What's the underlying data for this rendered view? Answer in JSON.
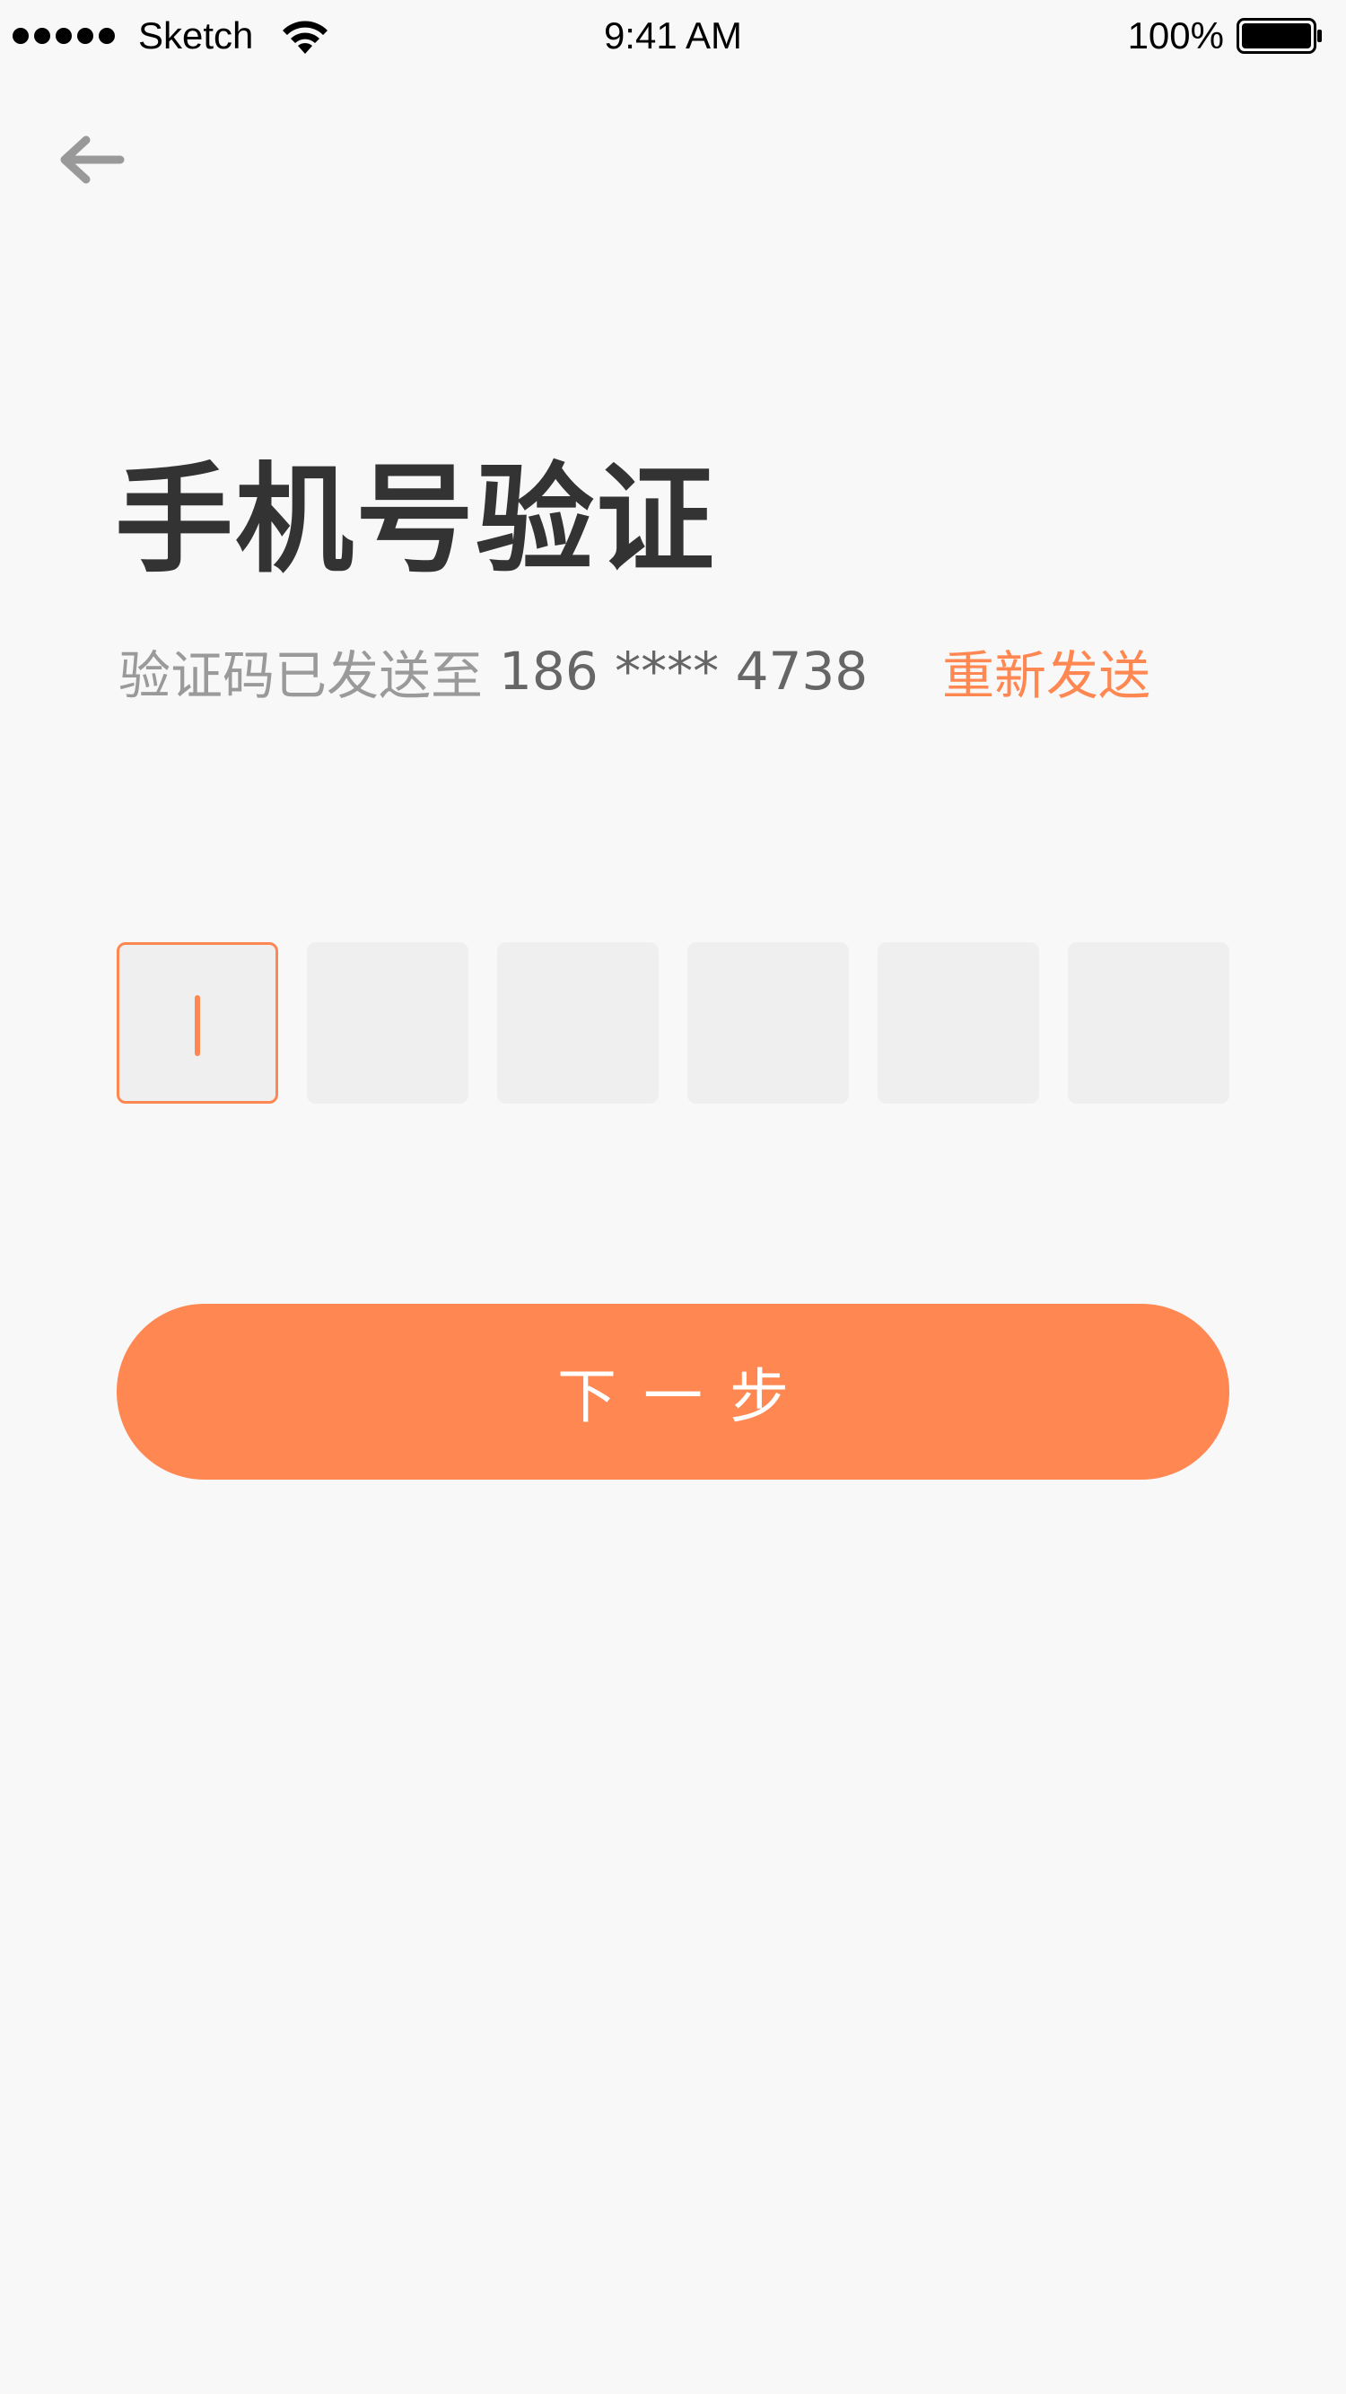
{
  "status_bar": {
    "carrier": "Sketch",
    "time": "9:41 AM",
    "battery_percent": "100%",
    "battery_level": 1.0,
    "signal_bars": 5
  },
  "navigation": {
    "back_icon": "arrow-left-icon"
  },
  "title": "手机号验证",
  "subtitle": {
    "sent_label": "验证码已发送至",
    "phone_number": "186 **** 4738",
    "resend_label": "重新发送"
  },
  "code_input": {
    "length": 6,
    "active_index": 0,
    "digits": [
      "",
      "",
      "",
      "",
      "",
      ""
    ]
  },
  "next_button": {
    "label": "下一步"
  },
  "colors": {
    "accent": "#ff8752",
    "background": "#f8f8f8",
    "title": "#333333",
    "secondary_text": "#9a9a9a",
    "code_box_fill": "#efefef"
  }
}
